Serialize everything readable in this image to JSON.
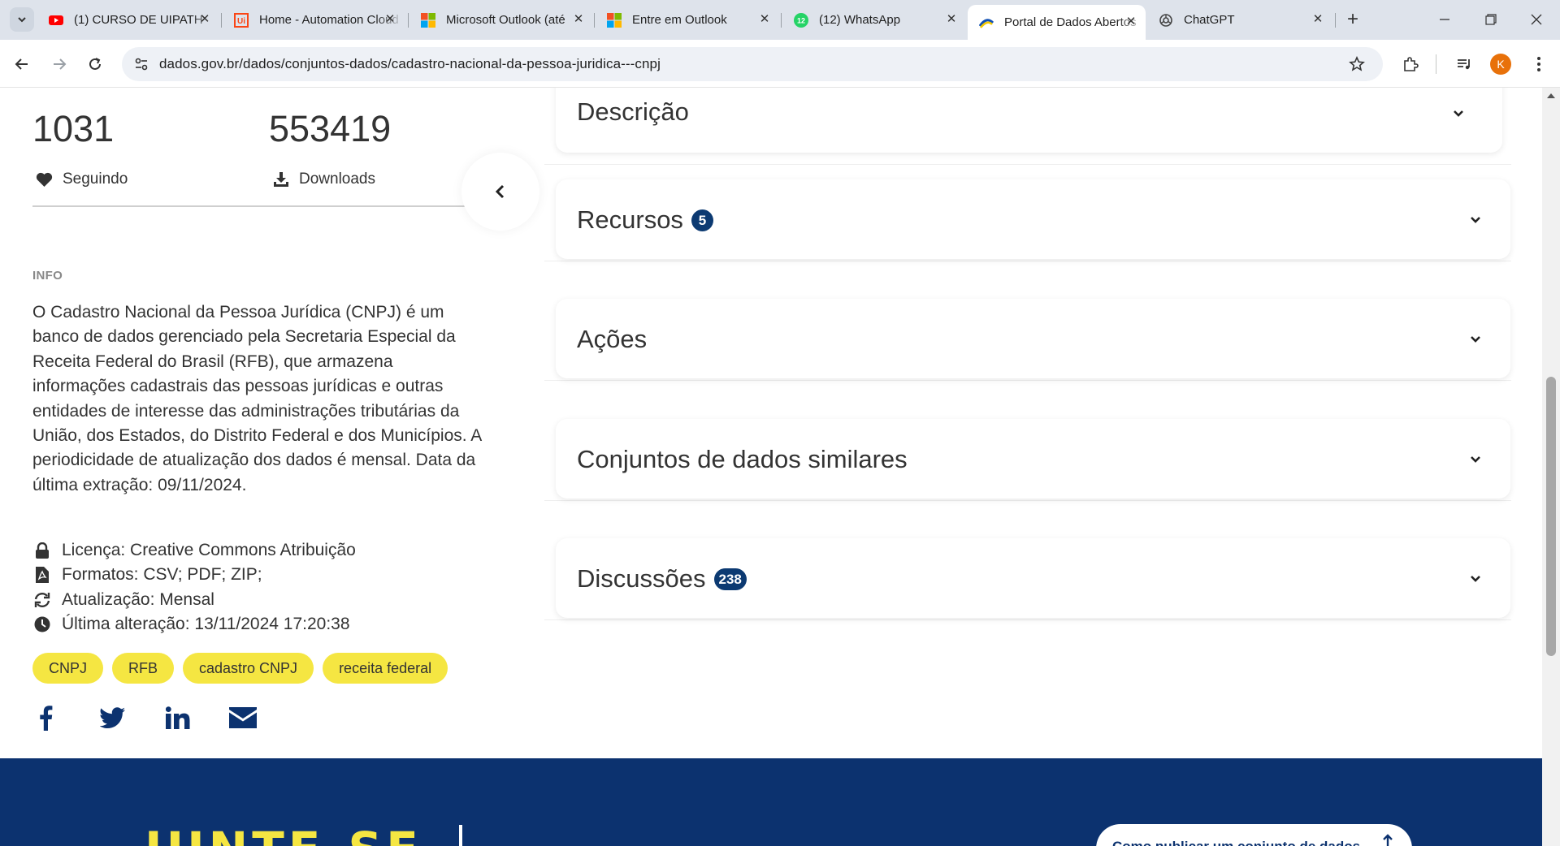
{
  "browser": {
    "tabs": [
      {
        "label": "(1) CURSO DE UIPATH",
        "icon": "youtube-icon"
      },
      {
        "label": "Home - Automation Cloud",
        "icon": "uipath-icon"
      },
      {
        "label": "Microsoft Outlook (até",
        "icon": "microsoft-icon"
      },
      {
        "label": "Entre em Outlook",
        "icon": "microsoft-icon"
      },
      {
        "label": "(12) WhatsApp",
        "icon": "whatsapp-icon",
        "badge": "12"
      },
      {
        "label": "Portal de Dados Abertos",
        "icon": "gov-icon",
        "active": true
      },
      {
        "label": "ChatGPT",
        "icon": "chatgpt-icon"
      }
    ],
    "url": "dados.gov.br/dados/conjuntos-dados/cadastro-nacional-da-pessoa-juridica---cnpj",
    "profile_initial": "K"
  },
  "stats": {
    "following_count": "1031",
    "following_label": "Seguindo",
    "downloads_count": "553419",
    "downloads_label": "Downloads"
  },
  "info": {
    "heading": "INFO",
    "description": "O Cadastro Nacional da Pessoa Jurídica (CNPJ) é um banco de dados gerenciado pela Secretaria Especial da Receita Federal do Brasil (RFB), que armazena informações cadastrais das pessoas jurídicas e outras entidades de interesse das administrações tributárias da União, dos Estados, do Distrito Federal e dos Municípios. A periodicidade de atualização dos dados é mensal. Data da última extração: 09/11/2024.",
    "license": "Licença: Creative Commons Atribuição",
    "formats": "Formatos: CSV; PDF; ZIP;",
    "update": "Atualização: Mensal",
    "last_change": "Última alteração: 13/11/2024 17:20:38"
  },
  "tags": [
    "CNPJ",
    "RFB",
    "cadastro CNPJ",
    "receita federal"
  ],
  "panels": {
    "descricao": {
      "title": "Descrição"
    },
    "recursos": {
      "title": "Recursos",
      "count": "5"
    },
    "acoes": {
      "title": "Ações"
    },
    "similares": {
      "title": "Conjuntos de dados similares"
    },
    "discussoes": {
      "title": "Discussões",
      "count": "238"
    }
  },
  "footer": {
    "title": "JUNTE-SE",
    "publish_button": "Como publicar um conjunto de dados"
  },
  "colors": {
    "brand_blue": "#0c326f",
    "badge_blue": "#0c3a72",
    "tag_yellow": "#f5e642",
    "social_blue": "#0c326f"
  }
}
